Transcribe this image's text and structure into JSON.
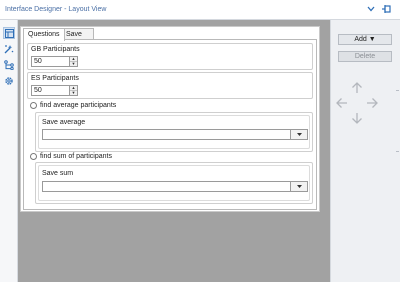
{
  "window": {
    "title": "Interface Designer - Layout View"
  },
  "titlebar_icons": [
    "chevron-down-icon",
    "pin-icon"
  ],
  "leftbar": {
    "icons": [
      "layout-view-icon",
      "tools-icon",
      "tree-view-icon",
      "settings-icon"
    ],
    "active_index": 0
  },
  "form": {
    "tabs": [
      {
        "label": "Questions",
        "active": true
      },
      {
        "label": "Save outputs",
        "active": false
      }
    ],
    "gb_participants": {
      "label": "GB Participants",
      "value": "50"
    },
    "es_participants": {
      "label": "ES Participants",
      "value": "50"
    },
    "average_option": {
      "label": "find average participants",
      "selected": false
    },
    "save_average": {
      "label": "Save average",
      "value": ""
    },
    "sum_option": {
      "label": "find sum of participants",
      "selected": false
    },
    "save_sum": {
      "label": "Save sum",
      "value": ""
    }
  },
  "side_panel": {
    "add_label": "Add ▼",
    "delete_label": "Delete",
    "delete_enabled": false,
    "move_arrows": [
      "arrow-up-icon",
      "arrow-left-icon",
      "arrow-right-icon",
      "arrow-down-icon"
    ]
  },
  "colors": {
    "canvas_background": "#a2a2a2",
    "title_text": "#4a6fa5",
    "accent_icon": "#2f6fb7",
    "arrow_icon": "#b3b7bd"
  }
}
